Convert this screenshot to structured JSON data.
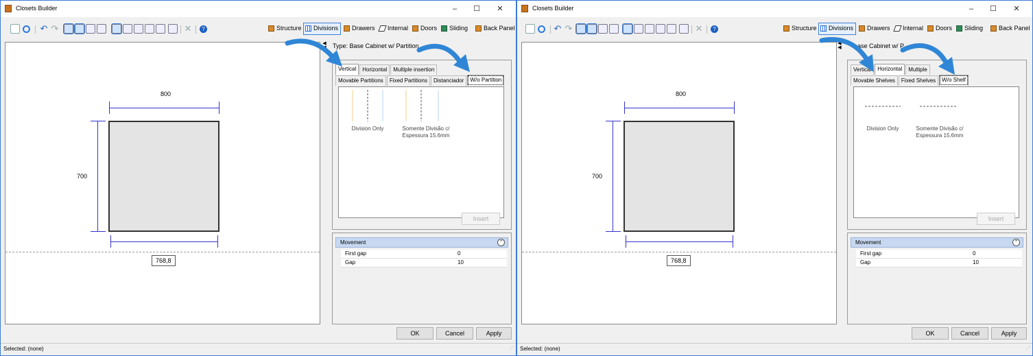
{
  "windows": [
    {
      "title": "Closets Builder",
      "tabs": [
        "Structure",
        "Divisions",
        "Drawers",
        "Internal",
        "Doors",
        "Sliding",
        "Back Panel"
      ],
      "selected_tab": "Divisions",
      "canvas": {
        "width_label": "800",
        "height_label": "700",
        "measured_width": "768,8"
      },
      "type_label": "Type: Base Cabinet w/ Partition",
      "main_tabs": [
        "Vertical",
        "Horizontal",
        "Multiple insertion"
      ],
      "active_main_tab": "Vertical",
      "sub_tabs": [
        "Movable Partitions",
        "Fixed Partitions",
        "Distanciador",
        "W/o Partition"
      ],
      "active_sub_tab": "W/o Partition",
      "items": [
        {
          "label_line1": "Division Only",
          "label_line2": ""
        },
        {
          "label_line1": "Somente Divisão c/",
          "label_line2": "Espessura 15.6mm"
        }
      ],
      "insert_label": "Insert",
      "movement": {
        "title": "Movement",
        "rows": [
          {
            "key": "First gap",
            "value": "0"
          },
          {
            "key": "Gap",
            "value": "10"
          }
        ]
      },
      "buttons": {
        "ok": "OK",
        "cancel": "Cancel",
        "apply": "Apply"
      },
      "status": "Selected: (none)"
    },
    {
      "title": "Closets Builder",
      "tabs": [
        "Structure",
        "Divisions",
        "Drawers",
        "Internal",
        "Doors",
        "Sliding",
        "Back Panel"
      ],
      "selected_tab": "Divisions",
      "canvas": {
        "width_label": "800",
        "height_label": "700",
        "measured_width": "768,8"
      },
      "type_label": "ase Cabinet w/ P",
      "main_tabs": [
        "Vertical",
        "Horizontal",
        "Multiple"
      ],
      "active_main_tab": "Horizontal",
      "sub_tabs": [
        "Movable Shelves",
        "Fixed Shelves",
        "W/o Shelf"
      ],
      "active_sub_tab": "W/o Shelf",
      "items": [
        {
          "label_line1": "Division Only",
          "label_line2": ""
        },
        {
          "label_line1": "Somente Divisão c/",
          "label_line2": "Espessura 15.6mm"
        }
      ],
      "insert_label": "Insert",
      "movement": {
        "title": "Movement",
        "rows": [
          {
            "key": "First gap",
            "value": "0"
          },
          {
            "key": "Gap",
            "value": "10"
          }
        ]
      },
      "buttons": {
        "ok": "OK",
        "cancel": "Cancel",
        "apply": "Apply"
      },
      "status": "Selected: (none)"
    }
  ],
  "colors": {
    "accent": "#3b7fd6",
    "arrow": "#2f86d6",
    "dimension": "#3333cc",
    "header": "#c7d8f0"
  },
  "window_controls": {
    "minimize": "–",
    "maximize": "☐",
    "close": "✕"
  }
}
